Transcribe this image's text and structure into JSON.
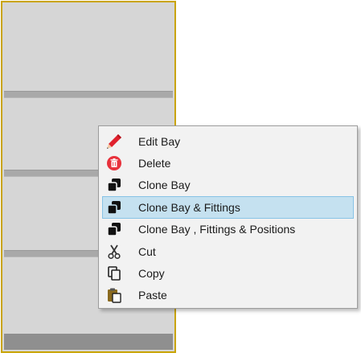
{
  "colors": {
    "bay_fill": "#d6d6d6",
    "bay_border": "#c9a400",
    "shelf": "#a9a9a9",
    "base": "#8f8f8f",
    "menu_bg": "#f2f2f2",
    "highlight_bg": "#c5e1f0",
    "highlight_border": "#87c3e6",
    "delete_red": "#e8323c",
    "edit_red": "#e0212d"
  },
  "context_menu": {
    "items": [
      {
        "label": "Edit Bay",
        "icon": "pencil-icon",
        "highlighted": false
      },
      {
        "label": "Delete",
        "icon": "delete-icon",
        "highlighted": false
      },
      {
        "label": "Clone Bay",
        "icon": "clone-icon",
        "highlighted": false
      },
      {
        "label": "Clone Bay & Fittings",
        "icon": "clone-icon",
        "highlighted": true
      },
      {
        "label": "Clone Bay , Fittings & Positions",
        "icon": "clone-icon",
        "highlighted": false
      },
      {
        "label": "Cut",
        "icon": "scissors-icon",
        "highlighted": false
      },
      {
        "label": "Copy",
        "icon": "copy-icon",
        "highlighted": false
      },
      {
        "label": "Paste",
        "icon": "paste-icon",
        "highlighted": false
      }
    ]
  }
}
